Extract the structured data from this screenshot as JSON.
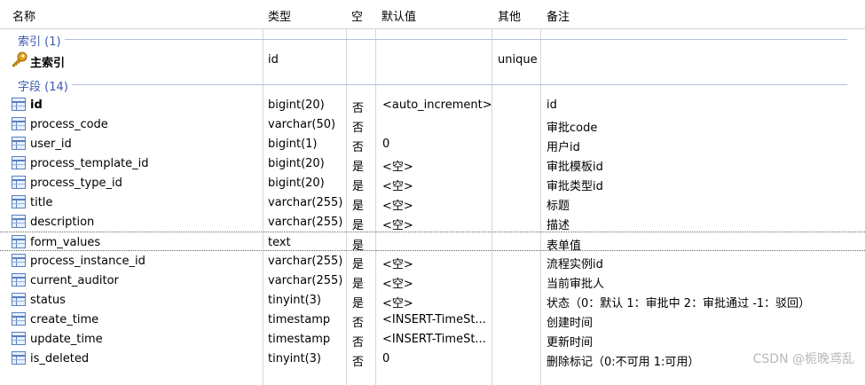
{
  "columns": [
    "名称",
    "类型",
    "空",
    "默认值",
    "其他",
    "备注"
  ],
  "index_group": {
    "label": "索引 (1)",
    "rows": [
      {
        "name": "主索引",
        "type": "id",
        "nullable": "",
        "default": "",
        "other": "unique",
        "comment": ""
      }
    ]
  },
  "field_group": {
    "label": "字段 (14)",
    "rows": [
      {
        "name": "id",
        "type": "bigint(20)",
        "nullable": "否",
        "default": "<auto_increment>",
        "other": "",
        "comment": "id"
      },
      {
        "name": "process_code",
        "type": "varchar(50)",
        "nullable": "否",
        "default": "",
        "other": "",
        "comment": "审批code"
      },
      {
        "name": "user_id",
        "type": "bigint(1)",
        "nullable": "否",
        "default": "0",
        "other": "",
        "comment": "用户id"
      },
      {
        "name": "process_template_id",
        "type": "bigint(20)",
        "nullable": "是",
        "default": "<空>",
        "other": "",
        "comment": "审批模板id"
      },
      {
        "name": "process_type_id",
        "type": "bigint(20)",
        "nullable": "是",
        "default": "<空>",
        "other": "",
        "comment": "审批类型id"
      },
      {
        "name": "title",
        "type": "varchar(255)",
        "nullable": "是",
        "default": "<空>",
        "other": "",
        "comment": "标题"
      },
      {
        "name": "description",
        "type": "varchar(255)",
        "nullable": "是",
        "default": "<空>",
        "other": "",
        "comment": "描述"
      },
      {
        "name": "form_values",
        "type": "text",
        "nullable": "是",
        "default": "",
        "other": "",
        "comment": "表单值"
      },
      {
        "name": "process_instance_id",
        "type": "varchar(255)",
        "nullable": "是",
        "default": "<空>",
        "other": "",
        "comment": "流程实例id"
      },
      {
        "name": "current_auditor",
        "type": "varchar(255)",
        "nullable": "是",
        "default": "<空>",
        "other": "",
        "comment": "当前审批人"
      },
      {
        "name": "status",
        "type": "tinyint(3)",
        "nullable": "是",
        "default": "<空>",
        "other": "",
        "comment": "状态（0：默认 1：审批中 2：审批通过 -1：驳回）"
      },
      {
        "name": "create_time",
        "type": "timestamp",
        "nullable": "否",
        "default": "<INSERT-TimeSt...",
        "other": "",
        "comment": "创建时间"
      },
      {
        "name": "update_time",
        "type": "timestamp",
        "nullable": "否",
        "default": "<INSERT-TimeSt...",
        "other": "",
        "comment": "更新时间"
      },
      {
        "name": "is_deleted",
        "type": "tinyint(3)",
        "nullable": "否",
        "default": "0",
        "other": "",
        "comment": "删除标记（0:不可用 1:可用）"
      }
    ]
  },
  "selected_row": "form_values",
  "watermark": "CSDN @栀晚鸢乱",
  "colors": {
    "group_label": "#3d5bb0",
    "grid": "#d7d7d7",
    "icon": "#5a7fbf",
    "key_icon": "#e0a020"
  }
}
